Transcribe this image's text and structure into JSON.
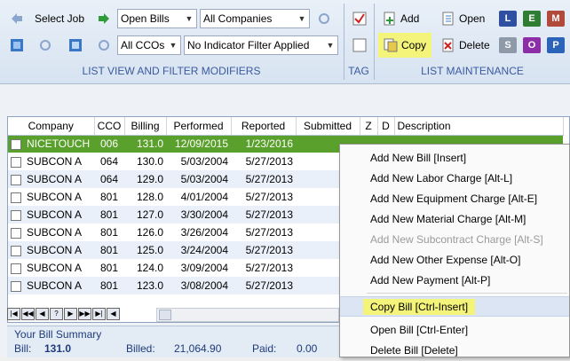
{
  "ribbon": {
    "select_job": "Select Job",
    "bills_filter": "Open Bills",
    "companies_filter": "All Companies",
    "cco_filter": "All CCOs",
    "indicator_filter": "No Indicator Filter Applied",
    "group_list_view": "LIST VIEW AND FILTER MODIFIERS",
    "group_tag": "TAG",
    "group_list_maintenance": "LIST MAINTENANCE",
    "add": "Add",
    "open": "Open",
    "copy": "Copy",
    "delete": "Delete",
    "letters": [
      {
        "label": "L",
        "color": "#2f4fa0"
      },
      {
        "label": "E",
        "color": "#2e7d32"
      },
      {
        "label": "M",
        "color": "#b24a3b"
      },
      {
        "label": "S",
        "color": "#8e9aa8"
      },
      {
        "label": "O",
        "color": "#8e2da8"
      },
      {
        "label": "P",
        "color": "#2b63b8"
      }
    ]
  },
  "grid": {
    "columns": [
      "Company",
      "CCO",
      "Billing",
      "Performed",
      "Reported",
      "Submitted",
      "Z",
      "D",
      "Description"
    ],
    "rows": [
      {
        "company": "NICETOUCH",
        "cco": "006",
        "billing": "131.0",
        "performed": "12/09/2015",
        "reported": "1/23/2016",
        "selected": true
      },
      {
        "company": "SUBCON A",
        "cco": "064",
        "billing": "130.0",
        "performed": "5/03/2004",
        "reported": "5/27/2013"
      },
      {
        "company": "SUBCON A",
        "cco": "064",
        "billing": "129.0",
        "performed": "5/03/2004",
        "reported": "5/27/2013"
      },
      {
        "company": "SUBCON A",
        "cco": "801",
        "billing": "128.0",
        "performed": "4/01/2004",
        "reported": "5/27/2013"
      },
      {
        "company": "SUBCON A",
        "cco": "801",
        "billing": "127.0",
        "performed": "3/30/2004",
        "reported": "5/27/2013"
      },
      {
        "company": "SUBCON A",
        "cco": "801",
        "billing": "126.0",
        "performed": "3/26/2004",
        "reported": "5/27/2013"
      },
      {
        "company": "SUBCON A",
        "cco": "801",
        "billing": "125.0",
        "performed": "3/24/2004",
        "reported": "5/27/2013"
      },
      {
        "company": "SUBCON A",
        "cco": "801",
        "billing": "124.0",
        "performed": "3/09/2004",
        "reported": "5/27/2013"
      },
      {
        "company": "SUBCON A",
        "cco": "801",
        "billing": "123.0",
        "performed": "3/08/2004",
        "reported": "5/27/2013"
      }
    ]
  },
  "summary": {
    "title": "Your Bill Summary",
    "bill_label": "Bill:",
    "bill_value": "131.0",
    "billed_label": "Billed:",
    "billed_value": "21,064.90",
    "paid_label": "Paid:",
    "paid_value": "0.00"
  },
  "context_menu": {
    "items": [
      {
        "label": "Add New Bill [Insert]",
        "disabled": false
      },
      {
        "label": "Add New Labor Charge [Alt-L]",
        "disabled": false
      },
      {
        "label": "Add New Equipment Charge [Alt-E]",
        "disabled": false
      },
      {
        "label": "Add New Material Charge [Alt-M]",
        "disabled": false
      },
      {
        "label": "Add New Subcontract Charge [Alt-S]",
        "disabled": true
      },
      {
        "label": "Add New Other Expense [Alt-O]",
        "disabled": false
      },
      {
        "label": "Add New Payment [Alt-P]",
        "disabled": false
      },
      {
        "label": "Copy Bill [Ctrl-Insert]",
        "disabled": false,
        "highlighted": true
      },
      {
        "label": "Open Bill [Ctrl-Enter]",
        "disabled": false
      },
      {
        "label": "Delete Bill [Delete]",
        "disabled": false
      }
    ]
  }
}
